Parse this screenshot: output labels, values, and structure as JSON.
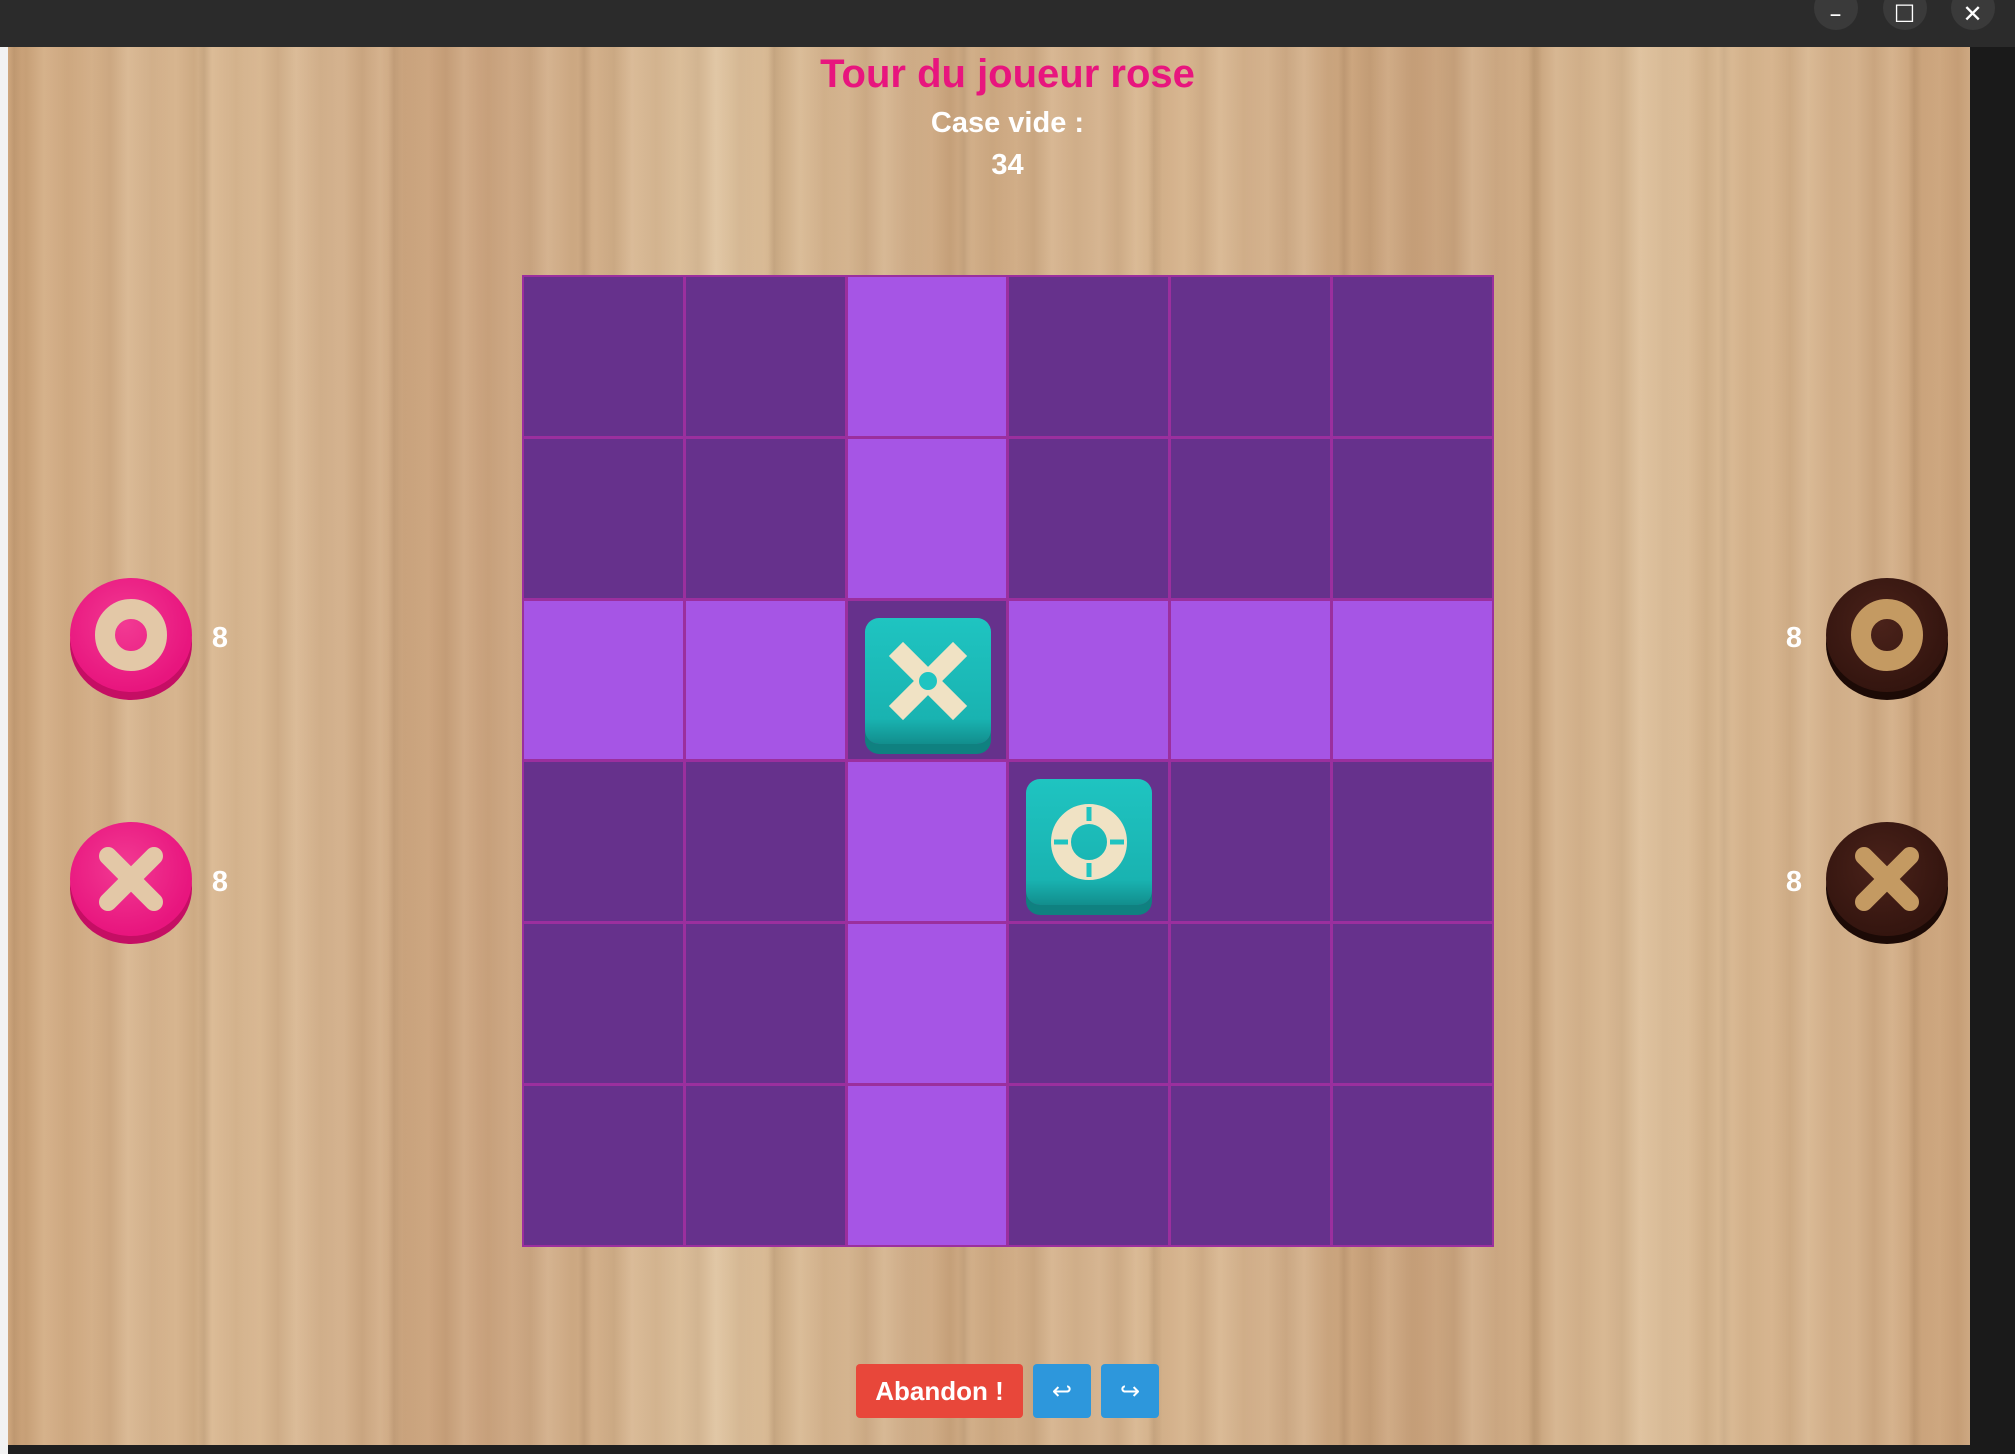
{
  "window": {
    "minimize_glyph": "–",
    "maximize_glyph": "☐",
    "close_glyph": "✕"
  },
  "header": {
    "turn_title": "Tour du joueur rose",
    "empty_label": "Case vide :",
    "empty_count": "34"
  },
  "colors": {
    "pink_player": "#e8157e",
    "dark_player": "#34150f",
    "cell_dark": "#66318c",
    "cell_highlight": "#a655e5",
    "tile": "#1fc4c1",
    "abandon_button": "#e8473a",
    "arrow_button": "#2d97dc"
  },
  "board": {
    "rows": 6,
    "cols": 6,
    "highlighted_cells": [
      [
        0,
        2
      ],
      [
        1,
        2
      ],
      [
        2,
        0
      ],
      [
        2,
        1
      ],
      [
        2,
        3
      ],
      [
        2,
        4
      ],
      [
        2,
        5
      ],
      [
        3,
        2
      ],
      [
        4,
        2
      ],
      [
        5,
        2
      ]
    ],
    "tiles": [
      {
        "row": 2,
        "col": 2,
        "symbol": "x-icon"
      },
      {
        "row": 3,
        "col": 3,
        "symbol": "o-icon"
      }
    ]
  },
  "players": {
    "pink": {
      "o_icon": "pink-o-piece-icon",
      "o_count": "8",
      "x_icon": "pink-x-piece-icon",
      "x_count": "8"
    },
    "dark": {
      "o_icon": "dark-o-piece-icon",
      "o_count": "8",
      "x_icon": "dark-x-piece-icon",
      "x_count": "8"
    }
  },
  "controls": {
    "abandon_label": "Abandon !",
    "undo_glyph": "↩",
    "redo_glyph": "↪"
  }
}
